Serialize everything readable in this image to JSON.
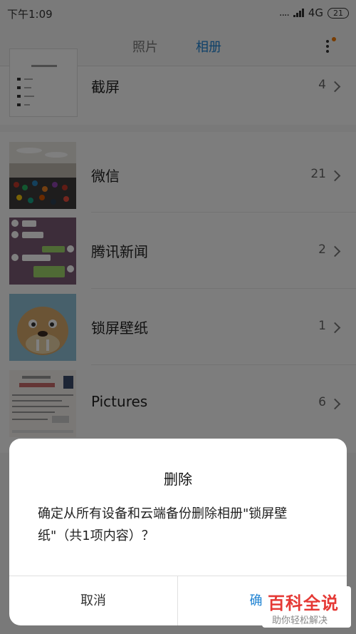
{
  "status": {
    "time": "下午1:09",
    "signal_dots": "....",
    "network": "4G",
    "battery": "21"
  },
  "header": {
    "tabs": [
      {
        "label": "照片",
        "active": false
      },
      {
        "label": "相册",
        "active": true
      }
    ],
    "more_icon": "more-vert-icon"
  },
  "albums": [
    {
      "name": "截屏",
      "count": "4"
    },
    {
      "name": "微信",
      "count": "21"
    },
    {
      "name": "腾讯新闻",
      "count": "2"
    },
    {
      "name": "锁屏壁纸",
      "count": "1"
    },
    {
      "name": "Pictures",
      "count": "6"
    }
  ],
  "dialog": {
    "title": "删除",
    "message": "确定从所有设备和云端备份删除相册\"锁屏壁纸\"（共1项内容）？",
    "cancel_label": "取消",
    "confirm_label": "确定"
  },
  "watermark": {
    "brand": "百科全说",
    "tagline": "助你轻松解决"
  },
  "colors": {
    "accent": "#1e82d2",
    "watermark_red": "#e53935"
  }
}
